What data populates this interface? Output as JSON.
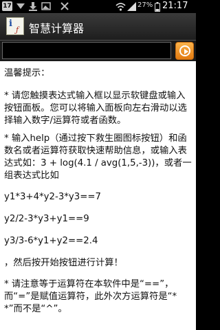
{
  "status_bar": {
    "notification_badge": "17",
    "battery_percent": "27%",
    "time": "21:17"
  },
  "app": {
    "title": "智慧计算器"
  },
  "expression_input": {
    "value": "",
    "placeholder": ""
  },
  "help": {
    "heading": "温馨提示：",
    "p1": "* 请您触摸表达式输入框以显示软键盘或输入按钮面板。您可以将输入面板向左右滑动以选择输入数字/运算符或者函数。",
    "p2": "* 输入help（通过按下救生圈图标按钮）和函数名或者运算符获取快速帮助信息，或输入表达式如：3 + log(4.1 / avg(1,5,-3))，或者一组表达式比如",
    "eq1": "y1*3+4*y2-3*y3==7",
    "eq2": "y2/2-3*y3+y1==9",
    "eq3": "y3/3-6*y1+y2==2.4",
    "p3": "，然后按开始按钮进行计算！",
    "p4": "* 请注意等于运算符在本软件中是“==”，而“=”是赋值运算符，此外次方运算符是“**”而不是“^”。"
  },
  "icons": {
    "status": [
      "notification-badge",
      "mail-icon",
      "download-icon",
      "image-icon",
      "close-icon",
      "wifi-icon",
      "signal-icon",
      "battery-icon"
    ],
    "go_button": "play-circle-icon"
  },
  "colors": {
    "go_button": "#f08a20",
    "title_bar": "#2a2a2a",
    "content_bg": "#ffffff"
  }
}
